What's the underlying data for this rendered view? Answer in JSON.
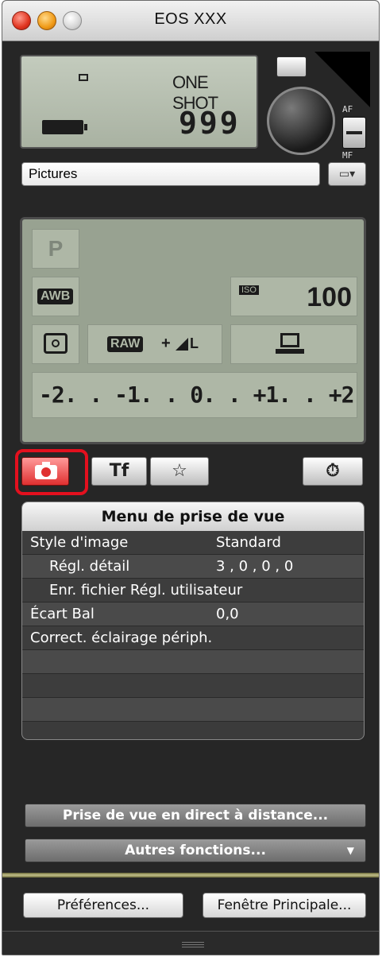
{
  "window": {
    "title": "EOS XXX"
  },
  "lcd_top": {
    "af_mode": "ONE SHOT",
    "shots_remaining": "999"
  },
  "af_switch": {
    "top_label": "AF",
    "bottom_label": "MF"
  },
  "folder": {
    "value": "Pictures",
    "button_glyph": "▾"
  },
  "lcd_main": {
    "shooting_mode": "P",
    "white_balance": "AWB",
    "iso_label": "ISO",
    "iso_value": "100",
    "quality_raw": "RAW",
    "quality_plus": "+",
    "quality_size": "L",
    "exposure_scale": "-2. . -1. . 0. . +1. . +2"
  },
  "tabs": [
    {
      "name": "tab-shooting",
      "glyph": "camera-icon",
      "active": true
    },
    {
      "name": "tab-setup",
      "glyph": "tools-icon",
      "label": "Tf"
    },
    {
      "name": "tab-mymenu",
      "glyph": "star-icon",
      "label": "☆"
    },
    {
      "name": "tab-timer",
      "glyph": "timer-icon",
      "label": "⏱"
    }
  ],
  "menu": {
    "title": "Menu de prise de vue",
    "rows": [
      {
        "label": "Style d'image",
        "value": "Standard",
        "indent": false
      },
      {
        "label": "Régl. détail",
        "value": "3 , 0 , 0 , 0",
        "indent": true
      },
      {
        "label": "Enr. fichier Régl. utilisateur",
        "value": "",
        "indent": true
      },
      {
        "label": "Écart Bal",
        "value": "0,0",
        "indent": false
      },
      {
        "label": "Correct. éclairage périph.",
        "value": "",
        "indent": false
      },
      {
        "label": "",
        "value": "",
        "indent": false
      },
      {
        "label": "",
        "value": "",
        "indent": false
      },
      {
        "label": "",
        "value": "",
        "indent": false
      }
    ]
  },
  "buttons": {
    "live_view": "Prise de vue en direct à distance...",
    "other_functions": "Autres fonctions...",
    "other_arrow": "▼",
    "preferences": "Préférences...",
    "main_window": "Fenêtre Principale..."
  },
  "colors": {
    "active_tab": "#e03030",
    "highlight_ring": "#e3101e",
    "lcd": "#aeb7a6"
  }
}
